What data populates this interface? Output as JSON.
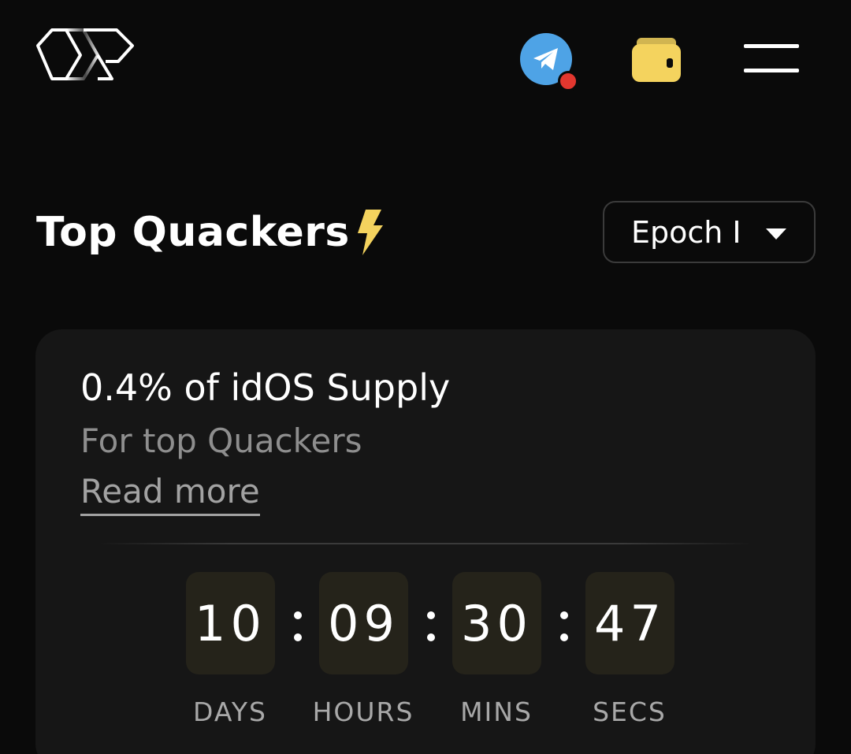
{
  "header": {
    "logo_icon": "brand-logo-icon",
    "telegram_icon": "telegram-icon",
    "notification_dot_color": "#e3372f",
    "wallet_icon": "wallet-icon",
    "menu_icon": "hamburger-menu-icon"
  },
  "leaderboard": {
    "title": "Top Quackers",
    "title_icon": "lightning-bolt-icon",
    "epoch_selector": {
      "selected": "Epoch I",
      "icon": "caret-down-icon"
    }
  },
  "reward_card": {
    "title": "0.4% of idOS Supply",
    "subtitle": "For top Quackers",
    "read_more_label": "Read more"
  },
  "countdown": {
    "days": "10",
    "hours": "09",
    "mins": "30",
    "secs": "47",
    "days_label": "DAYS",
    "hours_label": "HOURS",
    "mins_label": "MINS",
    "secs_label": "SECS"
  },
  "colors": {
    "background": "#0a0a0a",
    "card": "#161616",
    "accent_yellow": "#f4d35e",
    "telegram_blue": "#4ea3e6",
    "timer_box": "#25231a"
  }
}
